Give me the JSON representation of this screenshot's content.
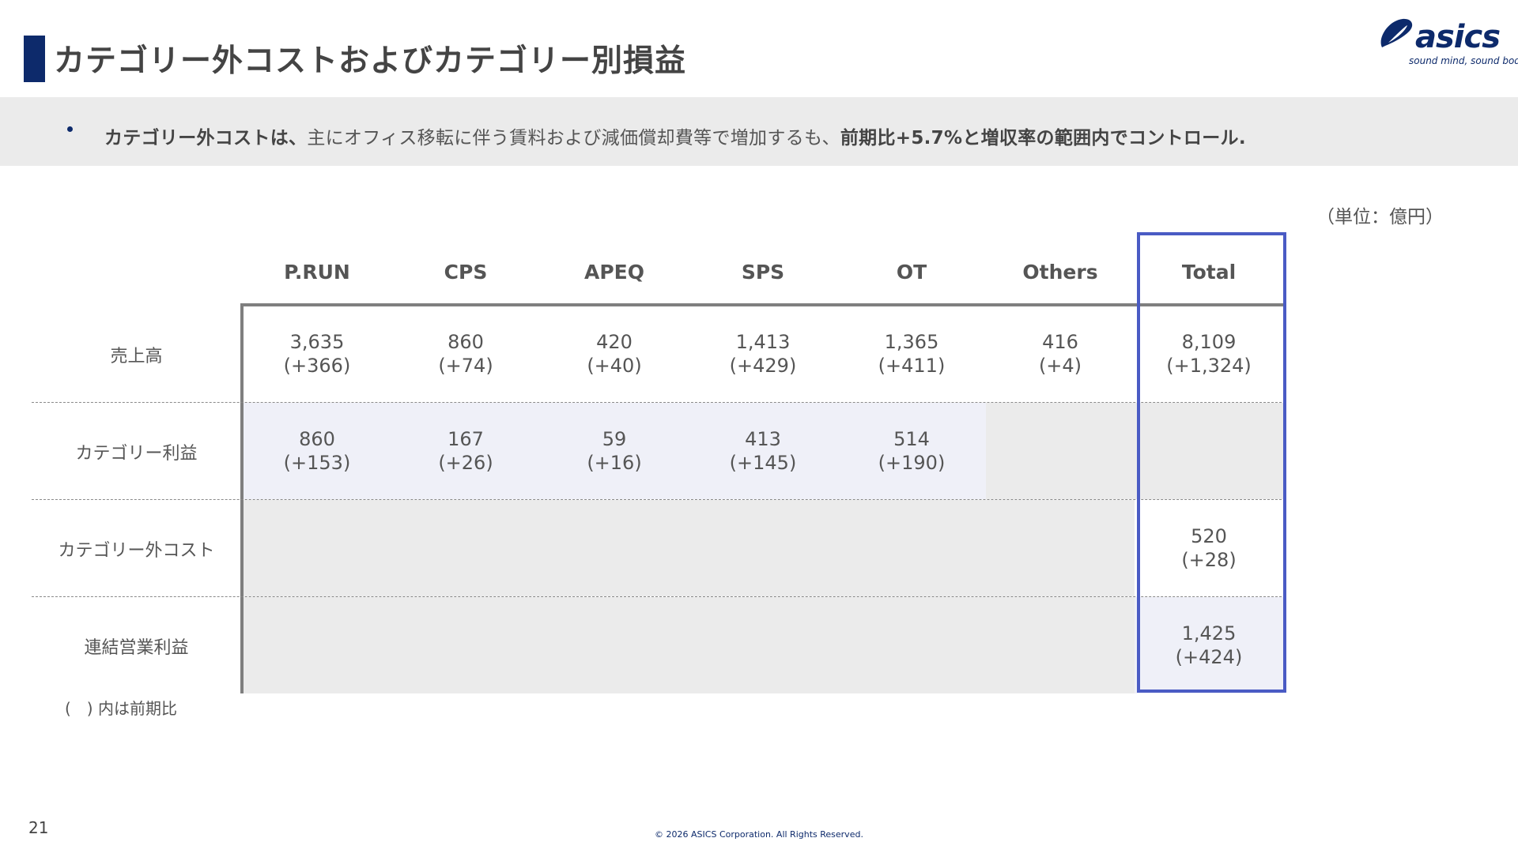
{
  "header": {
    "title": "カテゴリー外コストおよびカテゴリー別損益",
    "logo_text": "asics",
    "logo_tagline": "sound mind, sound body"
  },
  "summary": {
    "part1": "カテゴリー外コストは、",
    "part2": "主にオフィス移転に伴う賃料および減価償却費等で増加するも、",
    "part3": "前期比+5.7%と増収率の範囲内でコントロール."
  },
  "unit_label": "（単位：億円）",
  "table": {
    "columns": [
      "P.RUN",
      "CPS",
      "APEQ",
      "SPS",
      "OT",
      "Others",
      "Total"
    ],
    "rows": [
      {
        "label": "売上高",
        "cells": [
          {
            "value": "3,635",
            "change": "(+366)"
          },
          {
            "value": "860",
            "change": "(+74)"
          },
          {
            "value": "420",
            "change": "(+40)"
          },
          {
            "value": "1,413",
            "change": "(+429)"
          },
          {
            "value": "1,365",
            "change": "(+411)"
          },
          {
            "value": "416",
            "change": "(+4)"
          },
          {
            "value": "8,109",
            "change": "(+1,324)"
          }
        ]
      },
      {
        "label": "カテゴリー利益",
        "cells": [
          {
            "value": "860",
            "change": "(+153)"
          },
          {
            "value": "167",
            "change": "(+26)"
          },
          {
            "value": "59",
            "change": "(+16)"
          },
          {
            "value": "413",
            "change": "(+145)"
          },
          {
            "value": "514",
            "change": "(+190)"
          },
          {
            "value": "",
            "change": ""
          },
          {
            "value": "",
            "change": ""
          }
        ]
      },
      {
        "label": "カテゴリー外コスト",
        "cells": [
          {
            "value": "",
            "change": ""
          },
          {
            "value": "",
            "change": ""
          },
          {
            "value": "",
            "change": ""
          },
          {
            "value": "",
            "change": ""
          },
          {
            "value": "",
            "change": ""
          },
          {
            "value": "",
            "change": ""
          },
          {
            "value": "520",
            "change": "(+28)"
          }
        ]
      },
      {
        "label": "連結営業利益",
        "cells": [
          {
            "value": "",
            "change": ""
          },
          {
            "value": "",
            "change": ""
          },
          {
            "value": "",
            "change": ""
          },
          {
            "value": "",
            "change": ""
          },
          {
            "value": "",
            "change": ""
          },
          {
            "value": "",
            "change": ""
          },
          {
            "value": "1,425",
            "change": "(+424)"
          }
        ]
      }
    ]
  },
  "note": "(　) 内は前期比",
  "footer": {
    "page_number": "21",
    "copyright": "© 2026 ASICS Corporation. All Rights Reserved."
  },
  "colors": {
    "brand_navy": "#0d2a6b",
    "total_highlight": "#4a5bc4",
    "band_gray": "#ebebeb",
    "cell_blue": "#eff0f8"
  }
}
